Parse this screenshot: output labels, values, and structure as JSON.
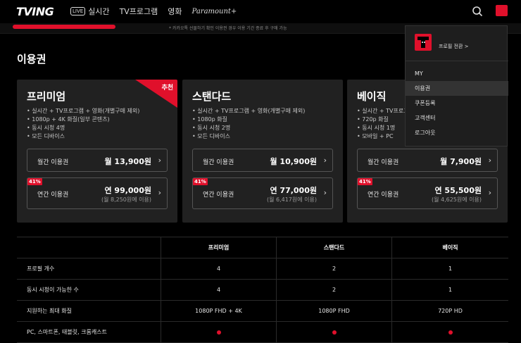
{
  "header": {
    "logo": "TVING",
    "nav": [
      {
        "badge": "LIVE",
        "label": "실시간"
      },
      {
        "label": "TV프로그램"
      },
      {
        "label": "영화"
      },
      {
        "label": "Paramount+"
      }
    ]
  },
  "banner": {
    "note": "* 카카오톡 선물하기 확인 이용권 경우 이용 기간 종료 후 구매 가능"
  },
  "section": {
    "title": "이용권"
  },
  "plans": [
    {
      "name": "프리미엄",
      "recommended": "추천",
      "features": [
        "실시간 + TV프로그램 + 영화(개별구매 제외)",
        "1080p + 4K 화질(일부 콘텐츠)",
        "동시 시청 4명",
        "모든 디바이스"
      ],
      "monthly": {
        "label": "월간 이용권",
        "price": "월 13,900원"
      },
      "yearly": {
        "discount": "41%",
        "label": "연간 이용권",
        "price": "연 99,000원",
        "sub": "(월 8,250원에 이용)"
      }
    },
    {
      "name": "스탠다드",
      "features": [
        "실시간 + TV프로그램 + 영화(개별구매 제외)",
        "1080p 화질",
        "동시 시청 2명",
        "모든 디바이스"
      ],
      "monthly": {
        "label": "월간 이용권",
        "price": "월 10,900원"
      },
      "yearly": {
        "discount": "41%",
        "label": "연간 이용권",
        "price": "연 77,000원",
        "sub": "(월 6,417원에 이용)"
      }
    },
    {
      "name": "베이직",
      "features": [
        "실시간 + TV프로그",
        "720p 화질",
        "동시 시청 1명",
        "모바일 + PC"
      ],
      "monthly": {
        "label": "월간 이용권",
        "price": "월 7,900원"
      },
      "yearly": {
        "discount": "41%",
        "label": "연간 이용권",
        "price": "연 55,500원",
        "sub": "(월 4,625원에 이용)"
      }
    }
  ],
  "dropdown": {
    "switch_label": "프로필 전환 >",
    "items": [
      "MY",
      "이용권",
      "쿠폰등록",
      "고객센터",
      "로그아웃"
    ]
  },
  "compare": {
    "headers": [
      "프리미엄",
      "스탠다드",
      "베이직"
    ],
    "rows": [
      {
        "label": "프로필 개수",
        "values": [
          "4",
          "2",
          "1"
        ]
      },
      {
        "label": "동시 시청이 가능한 수",
        "values": [
          "4",
          "2",
          "1"
        ]
      },
      {
        "label": "지원하는 최대 화질",
        "values": [
          "1080P FHD + 4K",
          "1080P FHD",
          "720P HD"
        ]
      },
      {
        "label": "PC, 스마트폰, 태블릿, 크롬캐스트",
        "values": [
          "",
          "",
          ""
        ]
      }
    ]
  },
  "colors": {
    "accent": "#e0102b",
    "card": "#212121",
    "background": "#000000"
  }
}
